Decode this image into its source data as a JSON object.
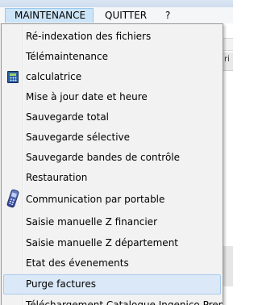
{
  "menubar": {
    "items": [
      "MAINTENANCE",
      "QUITTER",
      "?"
    ]
  },
  "dropdown": {
    "items": [
      {
        "label": "Ré-indexation des fichiers",
        "icon": null
      },
      {
        "label": "Télémaintenance",
        "icon": null
      },
      {
        "label": "calculatrice",
        "icon": "calculator-icon"
      },
      {
        "label": "Mise à jour date et heure",
        "icon": null
      },
      {
        "label": "Sauvegarde total",
        "icon": null
      },
      {
        "label": "Sauvegarde sélective",
        "icon": null
      },
      {
        "label": "Sauvegarde bandes de contrôle",
        "icon": null
      },
      {
        "label": "Restauration",
        "icon": null
      },
      {
        "label": "Communication par portable",
        "icon": "mobile-phone-icon"
      },
      {
        "label": "Saisie manuelle Z financier",
        "icon": null
      },
      {
        "label": "Saisie manuelle Z département",
        "icon": null
      },
      {
        "label": "Etat des évenements",
        "icon": null
      },
      {
        "label": "Purge factures",
        "icon": null,
        "selected": true
      },
      {
        "label": "Téléchargement Catalogue Ingenico Prepaid",
        "icon": null
      }
    ]
  },
  "background_window": {
    "fragment_text": "ri"
  },
  "colors": {
    "menu_active_bg": "#cce4f7",
    "selected_item_bg": "#dbe8f7",
    "dropdown_bg": "#f2f2f2"
  }
}
